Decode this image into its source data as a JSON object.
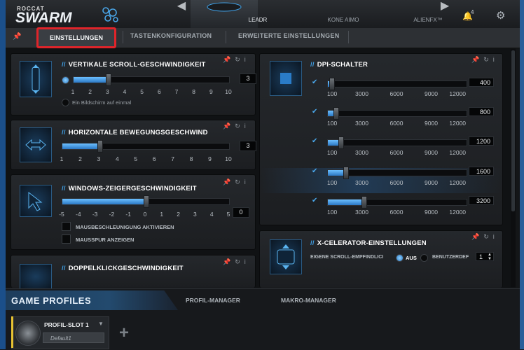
{
  "header": {
    "brand_small": "ROCCAT",
    "brand_big": "SWARM",
    "devices": [
      {
        "label": "LEADR"
      },
      {
        "label": "KONE AIMO"
      },
      {
        "label": "ALIENFX™"
      }
    ],
    "notifications_count": "4"
  },
  "tabs": {
    "items": [
      {
        "label": "EINSTELLUNGEN"
      },
      {
        "label": "TASTENKONFIGURATION"
      },
      {
        "label": "ERWEITERTE EINSTELLUNGEN"
      }
    ],
    "active": "EINSTELLUNGEN"
  },
  "scroll": {
    "title": "VERTIKALE SCROLL-GESCHWINDIGKEIT",
    "value": "3",
    "ticks": [
      "1",
      "2",
      "3",
      "4",
      "5",
      "6",
      "7",
      "8",
      "9",
      "10"
    ],
    "option_label": "Ein Bildschirm auf einmal",
    "level": 0.222
  },
  "horizontal": {
    "title": "HORIZONTALE BEWEGUNGSGESCHWIND",
    "value": "3",
    "ticks": [
      "1",
      "2",
      "3",
      "4",
      "5",
      "6",
      "7",
      "8",
      "9",
      "10"
    ],
    "level": 0.222
  },
  "windows": {
    "title": "WINDOWS-ZEIGERGESCHWINDIGKEIT",
    "value": "0",
    "ticks": [
      "-5",
      "-4",
      "-3",
      "-2",
      "-1",
      "0",
      "1",
      "2",
      "3",
      "4",
      "5"
    ],
    "check1": "MAUSBESCHLEUNIGUNG AKTIVIEREN",
    "check2": "MAUSSPUR ANZEIGEN",
    "level": 0.5
  },
  "doubleclick": {
    "title": "DOPPELKLICKGESCHWINDIGKEIT"
  },
  "dpi": {
    "title": "DPI-SCHALTER",
    "ticks": [
      "100",
      "3000",
      "6000",
      "9000",
      "12000"
    ],
    "levels": [
      {
        "value": "400",
        "fraction": 0.025
      },
      {
        "value": "800",
        "fraction": 0.058
      },
      {
        "value": "1200",
        "fraction": 0.092
      },
      {
        "value": "1600",
        "fraction": 0.126
      },
      {
        "value": "3200",
        "fraction": 0.26
      }
    ]
  },
  "xcelerator": {
    "title": "X-CELERATOR-EINSTELLUNGEN",
    "option_label": "EIGENE SCROLL-EMPFINDLICI",
    "off_label": "AUS",
    "custom_label": "BENUTZERDEF",
    "value": "1"
  },
  "bottom": {
    "game_profiles": "GAME PROFILES",
    "profile_manager": "PROFIL-MANAGER",
    "macro_manager": "MAKRO-MANAGER",
    "slot_name": "PROFIL-SLOT 1",
    "slot_profile": "Default1"
  }
}
